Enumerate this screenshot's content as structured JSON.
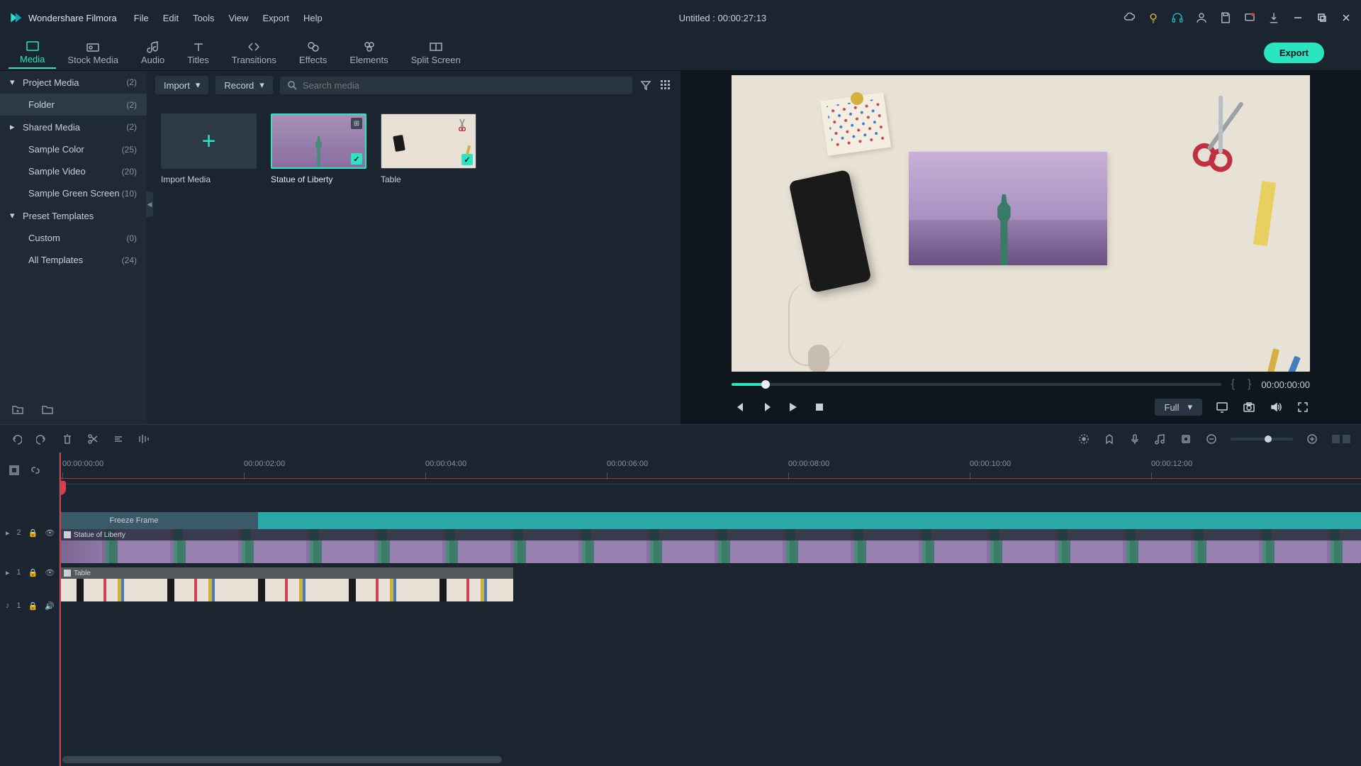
{
  "app_name": "Wondershare Filmora",
  "menu": [
    "File",
    "Edit",
    "Tools",
    "View",
    "Export",
    "Help"
  ],
  "title_center": "Untitled : 00:00:27:13",
  "tabs": [
    {
      "label": "Media"
    },
    {
      "label": "Stock Media"
    },
    {
      "label": "Audio"
    },
    {
      "label": "Titles"
    },
    {
      "label": "Transitions"
    },
    {
      "label": "Effects"
    },
    {
      "label": "Elements"
    },
    {
      "label": "Split Screen"
    }
  ],
  "export_label": "Export",
  "sidebar": {
    "items": [
      {
        "label": "Project Media",
        "count": "(2)",
        "expand": true
      },
      {
        "label": "Folder",
        "count": "(2)",
        "indent": true,
        "selected": true
      },
      {
        "label": "Shared Media",
        "count": "(2)",
        "collapsed": true
      },
      {
        "label": "Sample Color",
        "count": "(25)",
        "indent": true
      },
      {
        "label": "Sample Video",
        "count": "(20)",
        "indent": true
      },
      {
        "label": "Sample Green Screen",
        "count": "(10)",
        "indent": true
      },
      {
        "label": "Preset Templates",
        "count": "",
        "expand": true
      },
      {
        "label": "Custom",
        "count": "(0)",
        "indent": true
      },
      {
        "label": "All Templates",
        "count": "(24)",
        "indent": true
      }
    ]
  },
  "library": {
    "import_label": "Import",
    "record_label": "Record",
    "search_placeholder": "Search media",
    "items": [
      {
        "caption": "Import Media"
      },
      {
        "caption": "Statue of Liberty"
      },
      {
        "caption": "Table"
      }
    ]
  },
  "preview": {
    "timecode": "00:00:00:00",
    "in_bracket": "{",
    "out_bracket": "}",
    "quality": "Full"
  },
  "ruler": {
    "ticks": [
      "00:00:00:00",
      "00:00:02:00",
      "00:00:04:00",
      "00:00:06:00",
      "00:00:08:00",
      "00:00:10:00",
      "00:00:12:00"
    ]
  },
  "fx_label": "Freeze Frame",
  "clips": {
    "liberty": "Statue of Liberty",
    "table": "Table"
  },
  "track_labels": {
    "v2_icon": "▸",
    "v1_icon": "▸",
    "a1_icon": "♪"
  },
  "track_ids": {
    "v2": "2",
    "v1": "1",
    "a1": "1"
  }
}
